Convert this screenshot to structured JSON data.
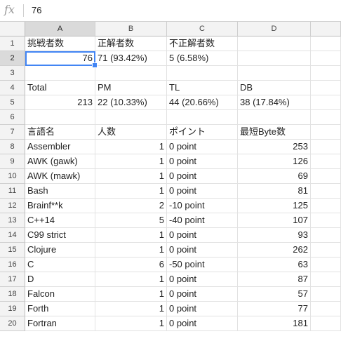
{
  "formula_bar": {
    "icon": "fx-icon",
    "value": "76"
  },
  "columns": [
    "A",
    "B",
    "C",
    "D"
  ],
  "rows": [
    {
      "n": "1",
      "a": "挑戦者数",
      "b": "正解者数",
      "c": "不正解者数",
      "d": ""
    },
    {
      "n": "2",
      "a": "76",
      "b": "71 (93.42%)",
      "c": "5 (6.58%)",
      "d": ""
    },
    {
      "n": "3",
      "a": "",
      "b": "",
      "c": "",
      "d": ""
    },
    {
      "n": "4",
      "a": "Total",
      "b": "PM",
      "c": "TL",
      "d": "DB"
    },
    {
      "n": "5",
      "a": "213",
      "b": "22 (10.33%)",
      "c": "44 (20.66%)",
      "d": "38 (17.84%)"
    },
    {
      "n": "6",
      "a": "",
      "b": "",
      "c": "",
      "d": ""
    },
    {
      "n": "7",
      "a": "言語名",
      "b": "人数",
      "c": "ポイント",
      "d": "最短Byte数"
    },
    {
      "n": "8",
      "a": "Assembler",
      "b": "1",
      "c": "0 point",
      "d": "253"
    },
    {
      "n": "9",
      "a": "AWK (gawk)",
      "b": "1",
      "c": "0 point",
      "d": "126"
    },
    {
      "n": "10",
      "a": "AWK (mawk)",
      "b": "1",
      "c": "0 point",
      "d": "69"
    },
    {
      "n": "11",
      "a": "Bash",
      "b": "1",
      "c": "0 point",
      "d": "81"
    },
    {
      "n": "12",
      "a": "Brainf**k",
      "b": "2",
      "c": "-10 point",
      "d": "125"
    },
    {
      "n": "13",
      "a": "C++14",
      "b": "5",
      "c": "-40 point",
      "d": "107"
    },
    {
      "n": "14",
      "a": "C99 strict",
      "b": "1",
      "c": "0 point",
      "d": "93"
    },
    {
      "n": "15",
      "a": "Clojure",
      "b": "1",
      "c": "0 point",
      "d": "262"
    },
    {
      "n": "16",
      "a": "C",
      "b": "6",
      "c": "-50 point",
      "d": "63"
    },
    {
      "n": "17",
      "a": "D",
      "b": "1",
      "c": "0 point",
      "d": "87"
    },
    {
      "n": "18",
      "a": "Falcon",
      "b": "1",
      "c": "0 point",
      "d": "57"
    },
    {
      "n": "19",
      "a": "Forth",
      "b": "1",
      "c": "0 point",
      "d": "77"
    },
    {
      "n": "20",
      "a": "Fortran",
      "b": "1",
      "c": "0 point",
      "d": "181"
    }
  ],
  "selected": {
    "column": "A",
    "row": "2"
  },
  "colors": {
    "selection_accent": "#4285f4",
    "header_bg": "#f3f3f3",
    "selected_header_bg": "#dadada"
  }
}
